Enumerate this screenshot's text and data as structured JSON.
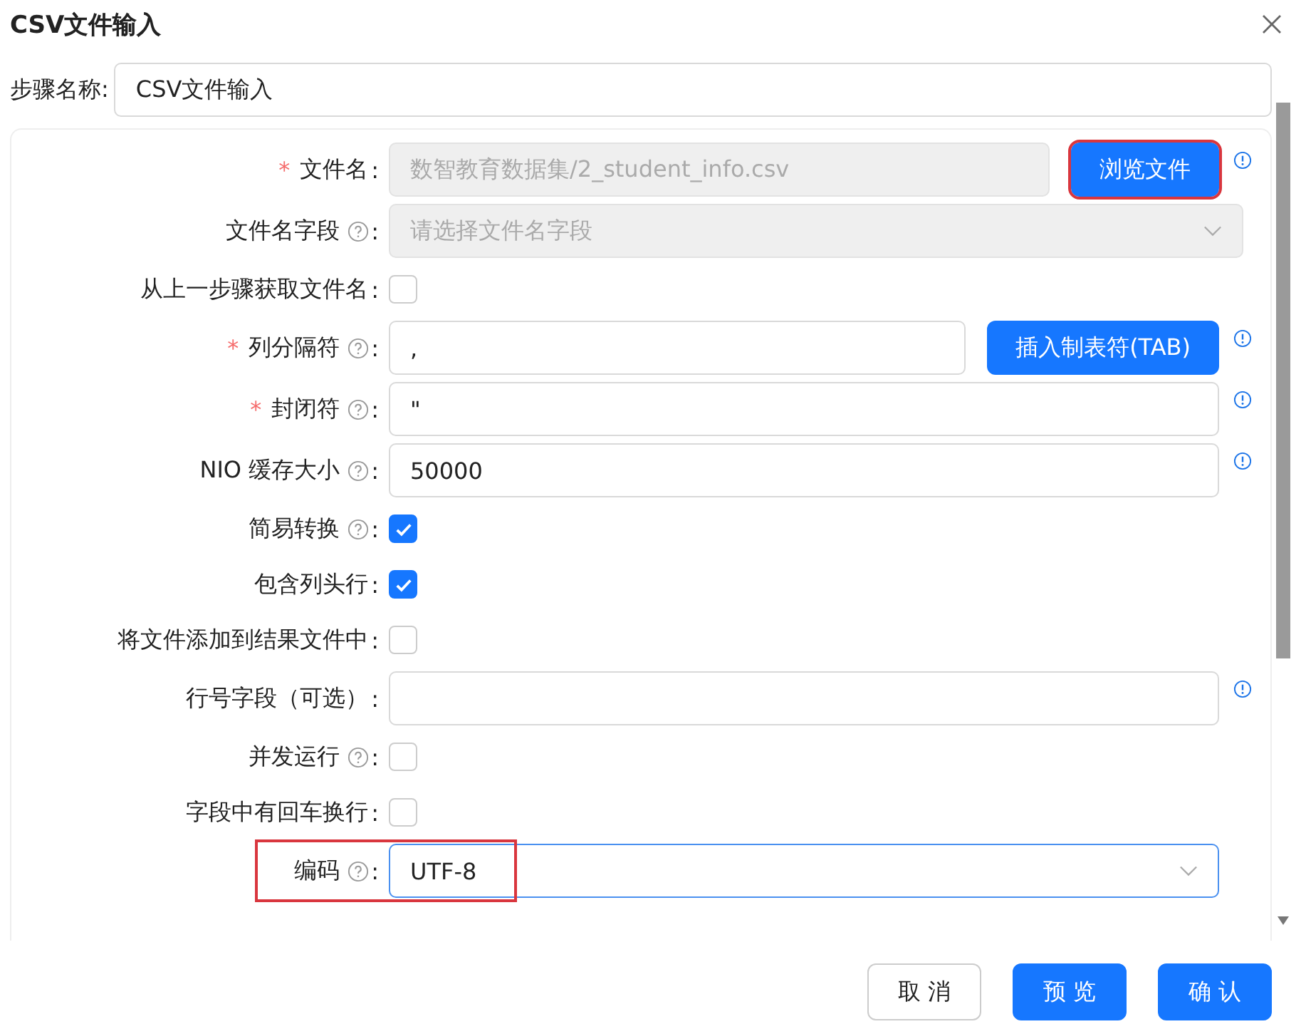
{
  "dialog": {
    "title": "CSV文件输入"
  },
  "step_name": {
    "label": "步骤名称",
    "colon": ":",
    "value": "CSV文件输入"
  },
  "fields": [
    {
      "kind": "text",
      "label": "文件名",
      "colon": ":",
      "asterisk": "*",
      "help": false,
      "info": true,
      "disabled": true,
      "value": "数智教育数据集/2_student_info.csv",
      "button": {
        "label": "浏览文件",
        "highlighted": true
      }
    },
    {
      "kind": "select",
      "label": "文件名字段",
      "colon": ":",
      "help": true,
      "info": false,
      "disabled": true,
      "placeholder": "请选择文件名字段"
    },
    {
      "kind": "checkbox",
      "label": "从上一步骤获取文件名",
      "colon": ":",
      "help": false,
      "checked": false
    },
    {
      "kind": "text",
      "label": "列分隔符",
      "colon": ":",
      "asterisk": "*",
      "help": true,
      "info": true,
      "disabled": false,
      "value": ",",
      "button": {
        "label": "插入制表符(TAB)",
        "highlighted": false
      }
    },
    {
      "kind": "text",
      "label": "封闭符",
      "colon": ":",
      "asterisk": "*",
      "help": true,
      "info": true,
      "disabled": false,
      "value": "\""
    },
    {
      "kind": "text",
      "label": "NIO 缓存大小",
      "colon": ":",
      "help": true,
      "info": true,
      "disabled": false,
      "value": "50000"
    },
    {
      "kind": "checkbox",
      "label": "简易转换",
      "colon": ":",
      "help": true,
      "checked": true
    },
    {
      "kind": "checkbox",
      "label": "包含列头行",
      "colon": ":",
      "help": false,
      "checked": true
    },
    {
      "kind": "checkbox",
      "label": "将文件添加到结果文件中",
      "colon": ":",
      "help": false,
      "checked": false
    },
    {
      "kind": "text",
      "label": "行号字段（可选）",
      "colon": ":",
      "help": false,
      "info": true,
      "disabled": false
    },
    {
      "kind": "checkbox",
      "label": "并发运行",
      "colon": ":",
      "help": true,
      "checked": false
    },
    {
      "kind": "checkbox",
      "label": "字段中有回车换行",
      "colon": ":",
      "help": false,
      "checked": false
    },
    {
      "kind": "select",
      "label": "编码",
      "colon": ":",
      "help": true,
      "info": false,
      "disabled": false,
      "focused": true,
      "highlighted": true,
      "value": "UTF-8"
    }
  ],
  "buttons": [
    {
      "label": "取 消",
      "kind": "default"
    },
    {
      "label": "预 览",
      "kind": "primary"
    },
    {
      "label": "确 认",
      "kind": "primary"
    }
  ]
}
